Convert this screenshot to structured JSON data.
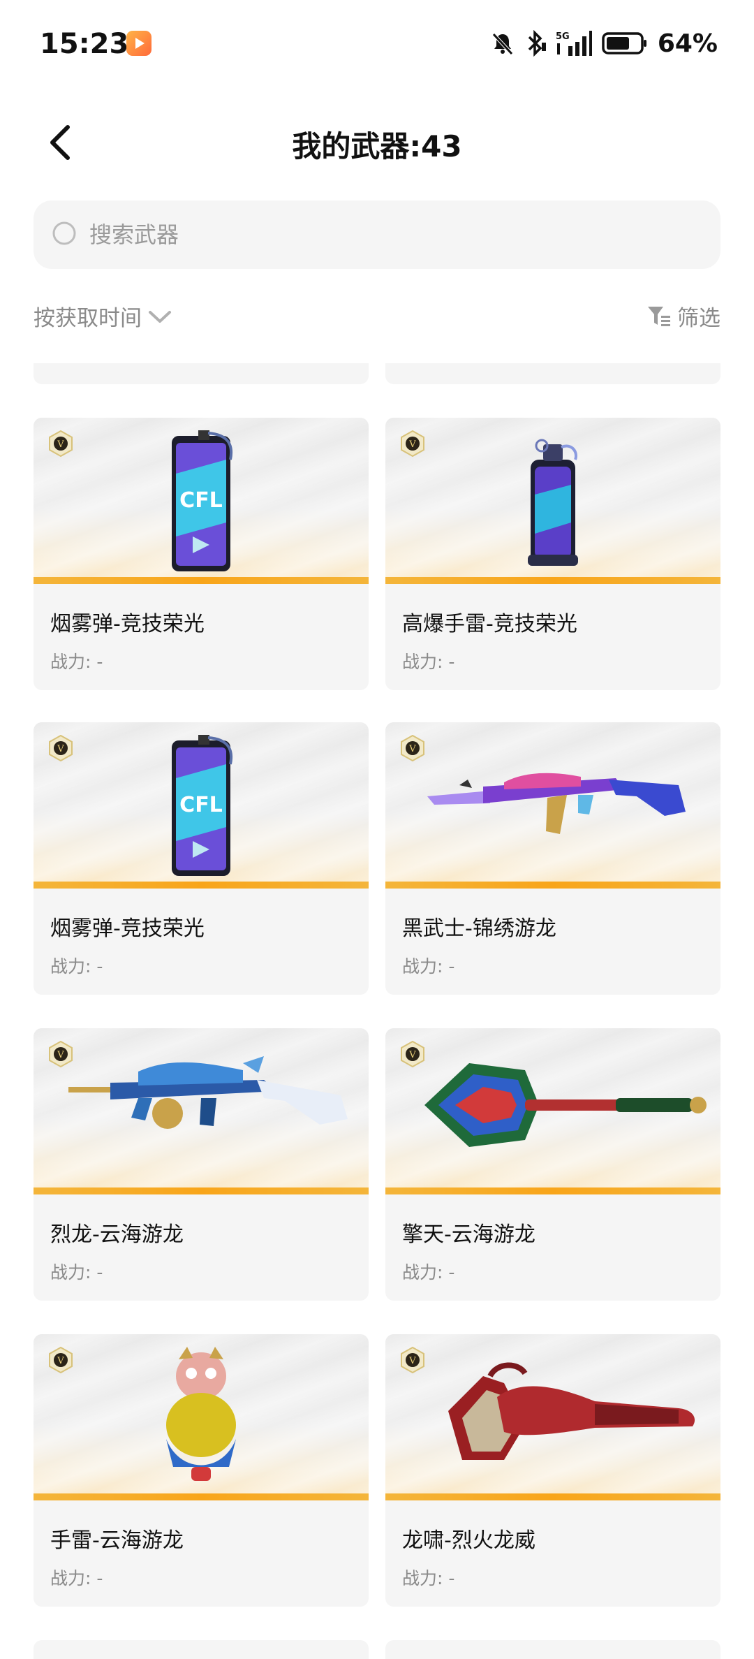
{
  "status_bar": {
    "time": "15:23",
    "network": "5G",
    "battery": "64%",
    "icons": [
      "app-icon",
      "mute-icon",
      "bluetooth-icon",
      "signal-icon",
      "battery-icon"
    ]
  },
  "header": {
    "title": "我的武器:43"
  },
  "search": {
    "placeholder": "搜索武器"
  },
  "sort": {
    "label": "按获取时间"
  },
  "filter": {
    "label": "筛选"
  },
  "weapons": [
    {
      "name": "烟雾弹-竞技荣光",
      "power": "战力: -",
      "art": "smoke-grenade"
    },
    {
      "name": "高爆手雷-竞技荣光",
      "power": "战力: -",
      "art": "frag-grenade"
    },
    {
      "name": "烟雾弹-竞技荣光",
      "power": "战力: -",
      "art": "smoke-grenade"
    },
    {
      "name": "黑武士-锦绣游龙",
      "power": "战力: -",
      "art": "rifle-purple"
    },
    {
      "name": "烈龙-云海游龙",
      "power": "战力: -",
      "art": "smg-dragon"
    },
    {
      "name": "擎天-云海游龙",
      "power": "战力: -",
      "art": "dragon-axe"
    },
    {
      "name": "手雷-云海游龙",
      "power": "战力: -",
      "art": "dragon-grenade"
    },
    {
      "name": "龙啸-烈火龙威",
      "power": "战力: -",
      "art": "red-axe"
    }
  ],
  "colors": {
    "accent_stripe": "#f8a51a",
    "card_bg": "#f5f5f5",
    "muted_text": "#8a8a8a"
  }
}
